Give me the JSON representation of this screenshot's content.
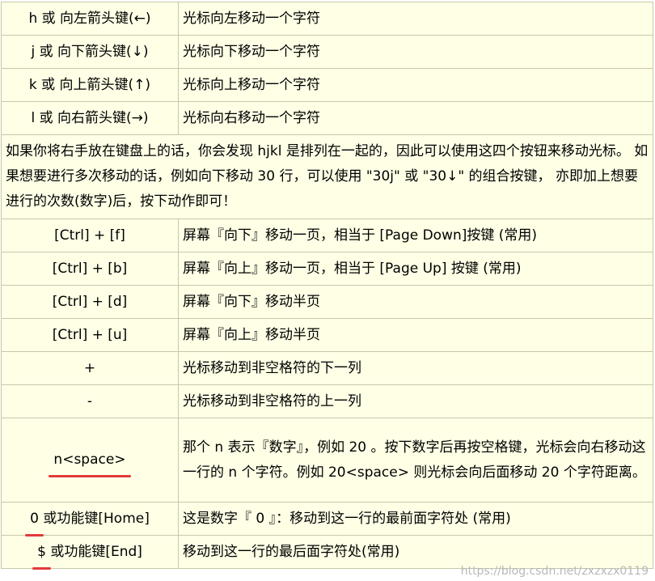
{
  "rows_top": [
    {
      "key": "h 或 向左箭头键(←)",
      "desc": "光标向左移动一个字符"
    },
    {
      "key": "j 或 向下箭头键(↓)",
      "desc": "光标向下移动一个字符"
    },
    {
      "key": "k 或 向上箭头键(↑)",
      "desc": "光标向上移动一个字符"
    },
    {
      "key": "l 或 向右箭头键(→)",
      "desc": "光标向右移动一个字符"
    }
  ],
  "note": "如果你将右手放在键盘上的话，你会发现 hjkl 是排列在一起的，因此可以使用这四个按钮来移动光标。 如果想要进行多次移动的话，例如向下移动 30 行，可以使用 \"30j\" 或 \"30↓\" 的组合按键， 亦即加上想要进行的次数(数字)后，按下动作即可！",
  "rows_bottom": [
    {
      "key": "[Ctrl] + [f]",
      "desc": "屏幕『向下』移动一页，相当于 [Page Down]按键 (常用)"
    },
    {
      "key": "[Ctrl] + [b]",
      "desc": "屏幕『向上』移动一页，相当于 [Page Up] 按键 (常用)"
    },
    {
      "key": "[Ctrl] + [d]",
      "desc": "屏幕『向下』移动半页"
    },
    {
      "key": "[Ctrl] + [u]",
      "desc": "屏幕『向上』移动半页"
    },
    {
      "key": "+",
      "desc": "光标移动到非空格符的下一列"
    },
    {
      "key": "-",
      "desc": "光标移动到非空格符的上一列"
    }
  ],
  "row_nspace": {
    "key": "n<space>",
    "desc": "那个 n 表示『数字』，例如 20 。按下数字后再按空格键，光标会向右移动这一行的 n 个字符。例如 20<space> 则光标会向后面移动 20 个字符距离。"
  },
  "row_zero": {
    "key_mark": "0",
    "key_rest": " 或功能键[Home]",
    "desc": "这是数字『 0 』：移动到这一行的最前面字符处 (常用)"
  },
  "row_dollar": {
    "key_mark": "$",
    "key_rest": " 或功能键[End]",
    "desc": "移动到这一行的最后面字符处(常用)"
  },
  "watermark": "https://blog.csdn.net/zxzxzx0119",
  "colors": {
    "cell_bg": "#ffffe6",
    "border": "#c8c8a8",
    "underline": "#e23a3a"
  }
}
